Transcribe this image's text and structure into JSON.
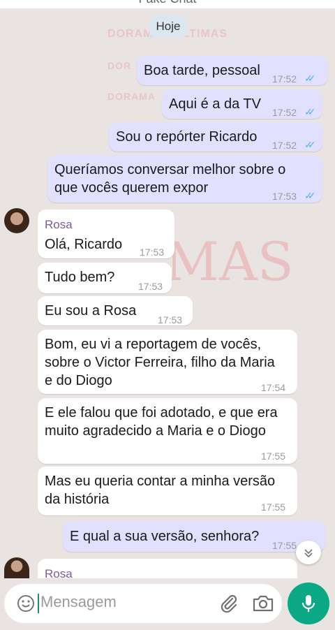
{
  "header": {
    "title": "Fake Chat"
  },
  "date_chip": "Hoje",
  "watermark": {
    "text_1": "DORAMAS ULTIMAS",
    "text_2": "DOR",
    "text_3": "DORAMA",
    "big_text": "MAS"
  },
  "messages": [
    {
      "direction": "out",
      "text": "Boa tarde, pessoal",
      "time": "17:52",
      "status": "read"
    },
    {
      "direction": "out",
      "text": "Aqui é a da TV",
      "time": "17:52",
      "status": "read"
    },
    {
      "direction": "out",
      "text": "Sou o repórter Ricardo",
      "time": "17:52",
      "status": "read"
    },
    {
      "direction": "out",
      "lines": [
        "Queríamos conversar melhor sobre o",
        "que vocês querem expor"
      ],
      "time": "17:53",
      "status": "read"
    },
    {
      "direction": "in",
      "sender": "Rosa",
      "text": "Olá, Ricardo",
      "time": "17:53"
    },
    {
      "direction": "in",
      "text": "Tudo bem?",
      "time": "17:53"
    },
    {
      "direction": "in",
      "text": "Eu sou a Rosa",
      "time": "17:53"
    },
    {
      "direction": "in",
      "lines": [
        "Bom, eu vi a reportagem de vocês,",
        "sobre o Victor Ferreira, filho da Maria",
        "e do Diogo"
      ],
      "time": "17:54"
    },
    {
      "direction": "in",
      "lines": [
        "E ele falou que foi adotado, e que era",
        "muito agradecido a Maria e o Diogo"
      ],
      "time": "17:55"
    },
    {
      "direction": "in",
      "lines": [
        "Mas eu queria contar a minha versão",
        "da história"
      ],
      "time": "17:55"
    },
    {
      "direction": "out",
      "text": "E qual a sua versão, senhora?",
      "time": "17:55",
      "status": "read"
    },
    {
      "direction": "in",
      "sender": "Rosa",
      "text": ""
    }
  ],
  "composer": {
    "placeholder": "Mensagem"
  },
  "icons": {
    "emoji": "emoji-icon",
    "attach": "paperclip-icon",
    "camera": "camera-icon",
    "mic": "mic-icon",
    "scroll": "chevron-double-down-icon",
    "ticks": "double-check-icon"
  },
  "colors": {
    "outgoing_bubble": "#e2e0ff",
    "incoming_bubble": "#ffffff",
    "read_ticks": "#4fb6ec",
    "sender_name": "#7e5b97",
    "mic_button": "#0aa884",
    "background": "#e9e4e1"
  }
}
